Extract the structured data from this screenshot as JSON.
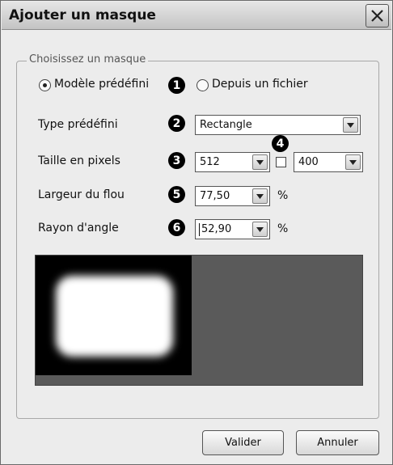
{
  "window": {
    "title": "Ajouter un masque",
    "close_icon": "close-x-icon"
  },
  "group": {
    "legend": "Choisissez un masque"
  },
  "source": {
    "option_predefined": "Modèle prédéfini",
    "option_file": "Depuis un fichier",
    "selected": "Modèle prédéfini"
  },
  "badges": [
    "1",
    "2",
    "3",
    "4",
    "5",
    "6"
  ],
  "fields": {
    "type_label": "Type prédéfini",
    "type_value": "Rectangle",
    "size_label": "Taille en pixels",
    "width_value": "512",
    "height_value": "400",
    "lock_ratio_checked": false,
    "blur_label": "Largeur du flou",
    "blur_value": "77,50",
    "blur_unit": "%",
    "radius_label": "Rayon d'angle",
    "radius_value": "52,90",
    "radius_unit": "%"
  },
  "buttons": {
    "ok": "Valider",
    "cancel": "Annuler"
  },
  "colors": {
    "preview_background": "#5a5a5a",
    "mask_black": "#000000",
    "mask_white": "#ffffff"
  }
}
